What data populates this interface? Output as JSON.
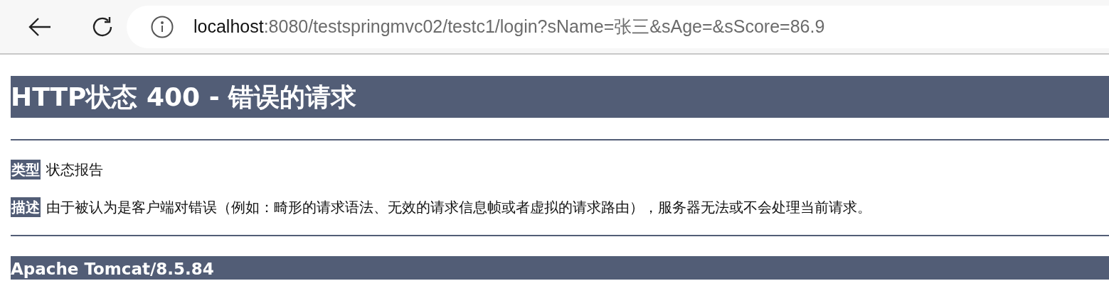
{
  "toolbar": {
    "address": {
      "host": "localhost",
      "rest": ":8080/testspringmvc02/testc1/login?sName=张三&sAge=&sScore=86.9"
    }
  },
  "page": {
    "title": "HTTP状态 400 - 错误的请求",
    "fields": [
      {
        "label": "类型",
        "value": "状态报告"
      },
      {
        "label": "描述",
        "value": "由于被认为是客户端对错误（例如：畸形的请求语法、无效的请求信息帧或者虚拟的请求路由），服务器无法或不会处理当前请求。"
      }
    ],
    "footer": "Apache Tomcat/8.5.84"
  }
}
